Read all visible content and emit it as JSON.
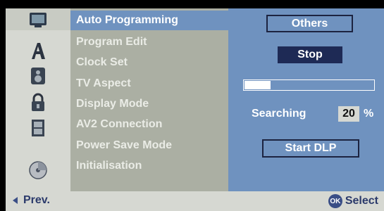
{
  "menu": {
    "items": [
      {
        "label": "Auto Programming",
        "active": true
      },
      {
        "label": "Program Edit",
        "active": false
      },
      {
        "label": "Clock Set",
        "active": false
      },
      {
        "label": "TV Aspect",
        "active": false
      },
      {
        "label": "Display Mode",
        "active": false
      },
      {
        "label": "AV2 Connection",
        "active": false
      },
      {
        "label": "Power Save Mode",
        "active": false
      },
      {
        "label": "Initialisation",
        "active": false
      }
    ]
  },
  "icons": [
    {
      "name": "tv-icon",
      "active": true
    },
    {
      "name": "language-a-icon",
      "active": false
    },
    {
      "name": "speaker-icon",
      "active": false
    },
    {
      "name": "lock-icon",
      "active": false
    },
    {
      "name": "film-reel-icon",
      "active": false
    },
    {
      "name": "disc-icon",
      "active": false
    }
  ],
  "panel": {
    "others_label": "Others",
    "stop_label": "Stop",
    "progress_fraction": 0.2,
    "searching_label": "Searching",
    "percent_value": "20",
    "percent_sign": "%",
    "start_dlp_label": "Start DLP"
  },
  "footer": {
    "prev_label": "Prev.",
    "ok_badge": "OK",
    "select_label": "Select"
  },
  "colors": {
    "menu_highlight": "#6f92bf",
    "menu_bg": "#abafa3",
    "icon_bg": "#d6d8d2",
    "button_dark": "#1e2a55"
  }
}
